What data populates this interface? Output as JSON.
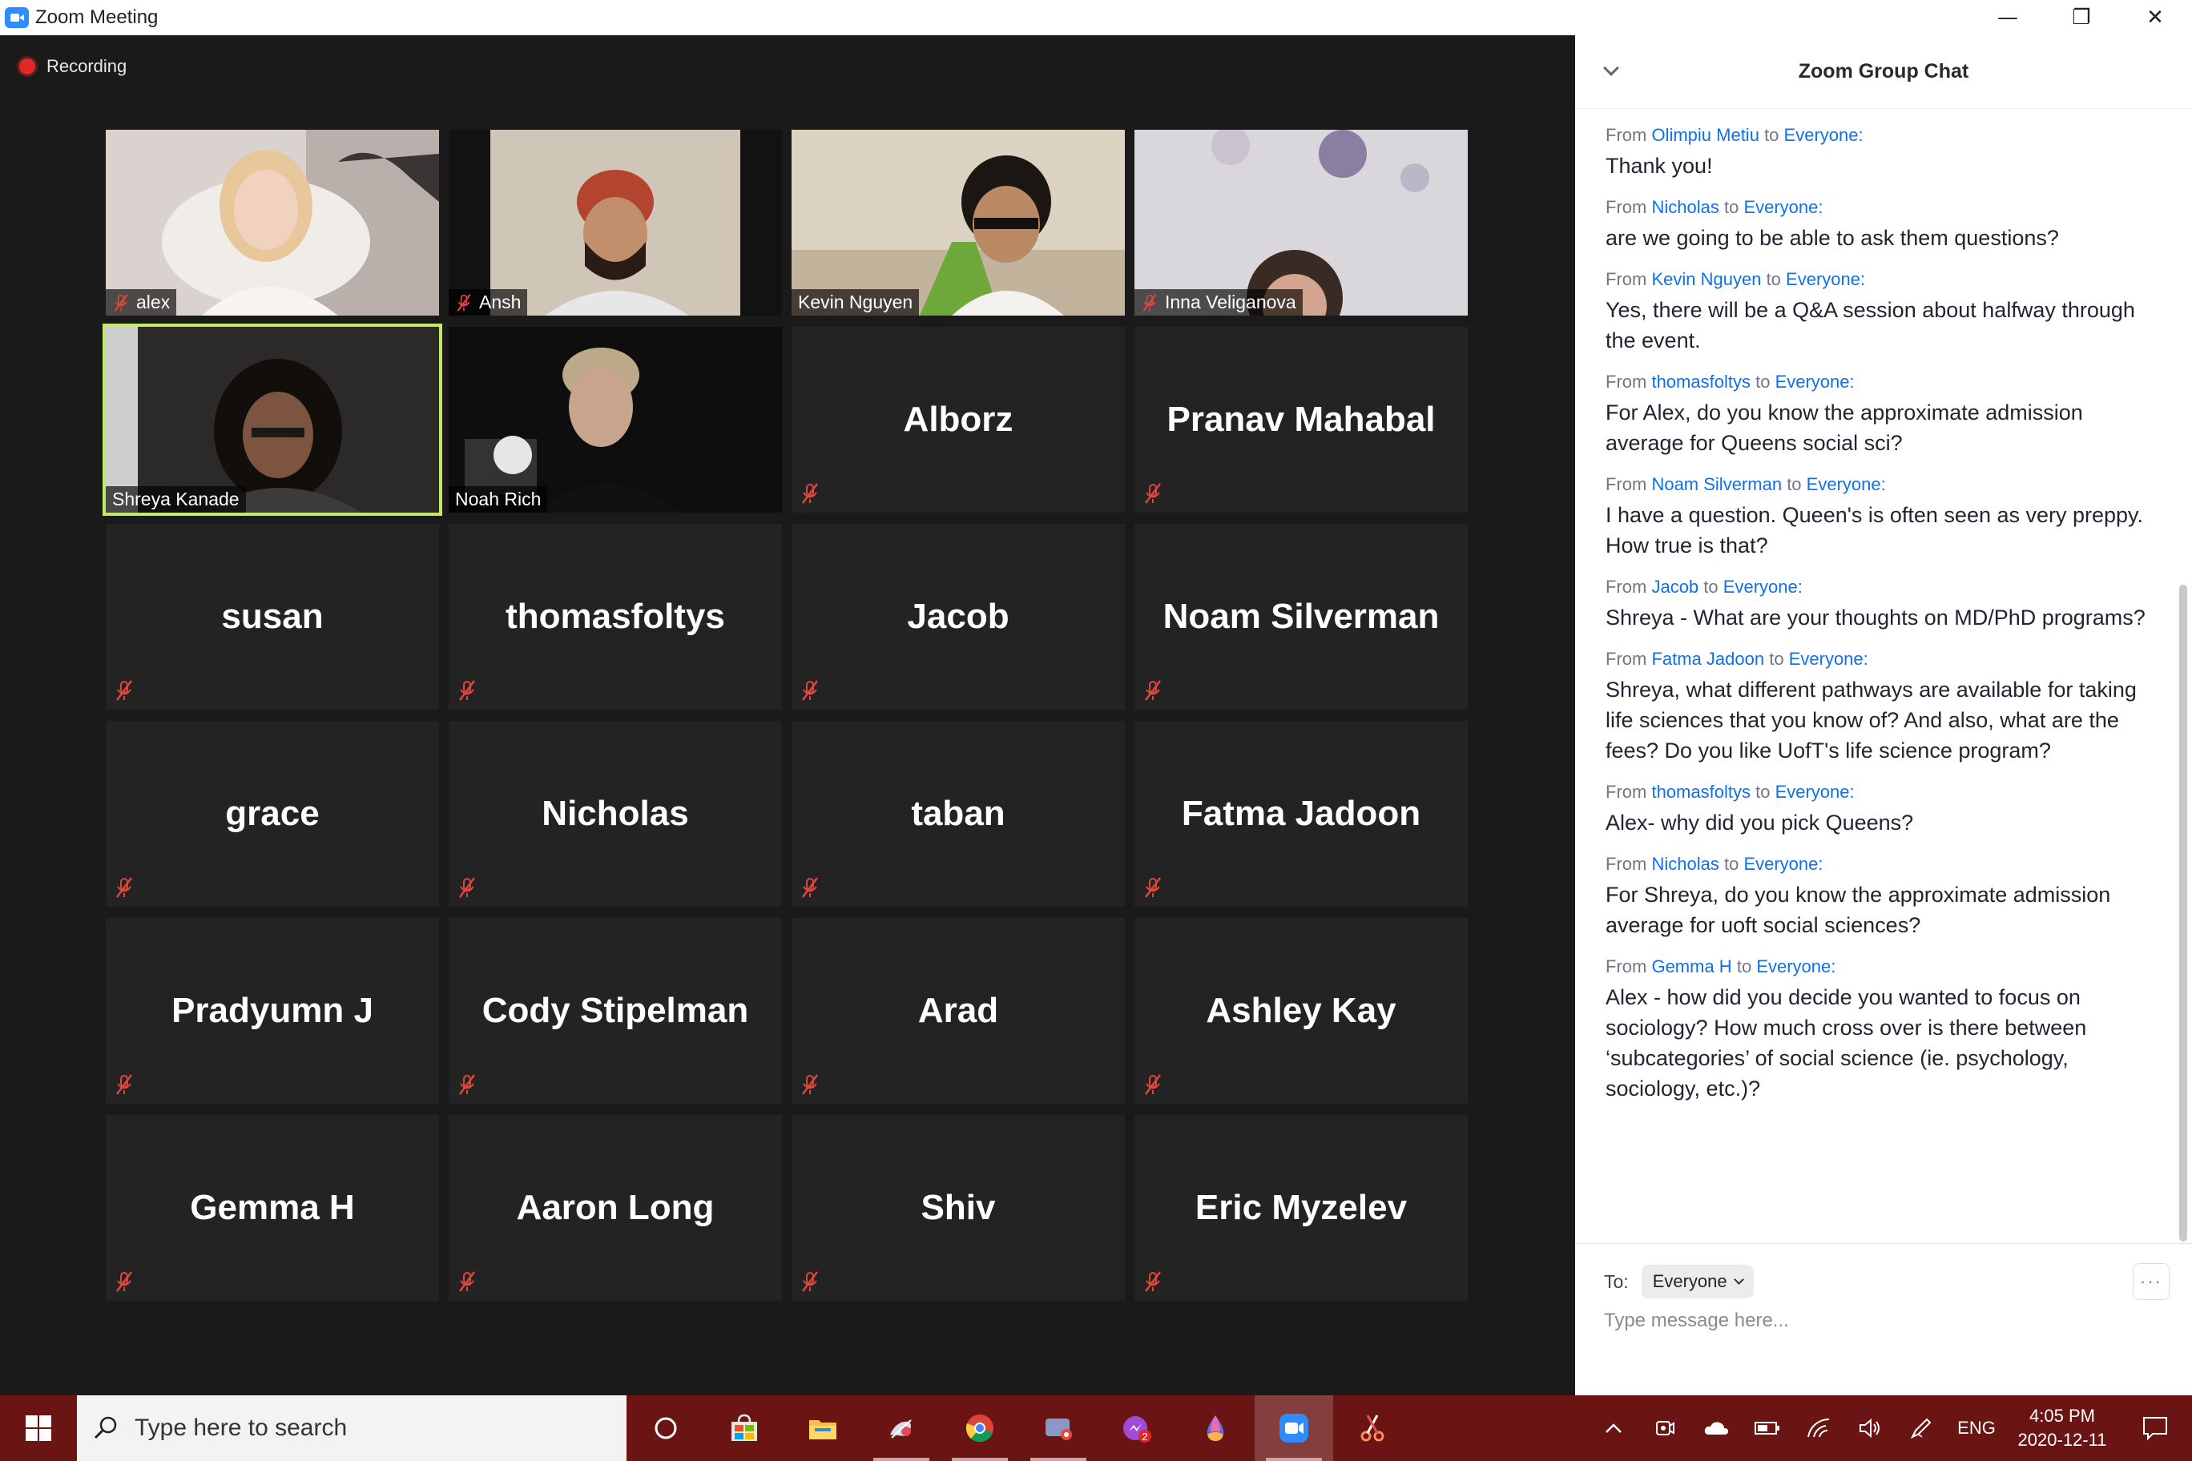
{
  "window": {
    "title": "Zoom Meeting",
    "controls": [
      "—",
      "❐",
      "✕"
    ]
  },
  "recording": {
    "label": "Recording"
  },
  "participants": {
    "video": [
      {
        "name": "alex",
        "muted": true
      },
      {
        "name": "Ansh",
        "muted": true
      },
      {
        "name": "Kevin Nguyen",
        "muted": false
      },
      {
        "name": "Inna Veliganova",
        "muted": true
      },
      {
        "name": "Shreya Kanade",
        "muted": false,
        "active": true
      },
      {
        "name": "Noah Rich",
        "muted": false
      }
    ],
    "names": [
      "Alborz",
      "Pranav Mahabal",
      "susan",
      "thomasfoltys",
      "Jacob",
      "Noam Silverman",
      "grace",
      "Nicholas",
      "taban",
      "Fatma Jadoon",
      "Pradyumn J",
      "Cody Stipelman",
      "Arad",
      "Ashley Kay",
      "Gemma H",
      "Aaron Long",
      "Shiv",
      "Eric Myzelev"
    ]
  },
  "chat": {
    "title": "Zoom Group Chat",
    "from_word": "From",
    "to_word": "to",
    "messages": [
      {
        "from": "Olimpiu Metiu",
        "to": "Everyone:",
        "text": "Thank you!"
      },
      {
        "from": "Nicholas",
        "to": "Everyone:",
        "text": "are we going to be able to ask them questions?"
      },
      {
        "from": "Kevin Nguyen",
        "to": "Everyone:",
        "text": "Yes, there will be a Q&A session about halfway through the event."
      },
      {
        "from": "thomasfoltys",
        "to": "Everyone:",
        "text": "For Alex, do you know the approximate admission average for Queens social sci?"
      },
      {
        "from": "Noam Silverman",
        "to": "Everyone:",
        "text": "I have a question. Queen's is often seen as very preppy. How true is that?"
      },
      {
        "from": "Jacob",
        "to": "Everyone:",
        "text": "Shreya - What are your thoughts on MD/PhD programs?"
      },
      {
        "from": "Fatma Jadoon",
        "to": "Everyone:",
        "text": "Shreya, what different pathways are available for taking life sciences that you know of? And also, what are the fees? Do you like UofT's life science program?"
      },
      {
        "from": "thomasfoltys",
        "to": "Everyone:",
        "text": "Alex- why did you pick Queens?"
      },
      {
        "from": "Nicholas",
        "to": "Everyone:",
        "text": "For Shreya, do you know the approximate admission average for uoft social sciences?"
      },
      {
        "from": "Gemma H",
        "to": "Everyone:",
        "text": "Alex - how did you decide you wanted to focus on sociology? How much cross over is there between ‘subcategories’ of social science (ie. psychology, sociology, etc.)?"
      }
    ],
    "footer": {
      "to_label": "To:",
      "recipient": "Everyone",
      "more": "···",
      "input_placeholder": "Type message here..."
    }
  },
  "taskbar": {
    "search_placeholder": "Type here to search",
    "language": "ENG",
    "time": "4:05 PM",
    "date": "2020-12-11",
    "messenger_badge": "2"
  },
  "colors": {
    "accent": "#0e71eb",
    "taskbar": "#6b1414",
    "active_speaker": "#c4e86a",
    "recording": "#e02828",
    "mute": "#e0453b"
  }
}
